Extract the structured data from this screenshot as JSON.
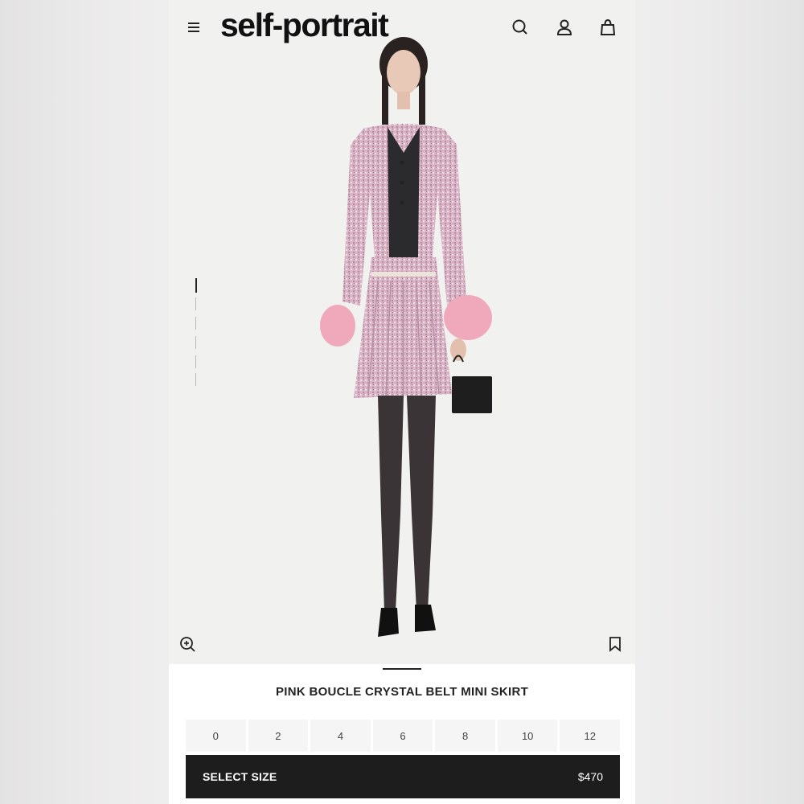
{
  "header": {
    "logo": "self-portrait",
    "icons": [
      "menu-icon",
      "search-icon",
      "account-icon",
      "bag-icon"
    ]
  },
  "gallery": {
    "image_count": 5,
    "active_index": 0
  },
  "product": {
    "title": "PINK BOUCLE CRYSTAL BELT MINI SKIRT",
    "sizes": [
      "0",
      "2",
      "4",
      "6",
      "8",
      "10",
      "12"
    ],
    "cta_label": "SELECT SIZE",
    "price": "$470"
  },
  "colors": {
    "accent": "#1d1d1d",
    "size_bg": "#f5f5f5",
    "tweed_pink": "#d9b3c6"
  }
}
